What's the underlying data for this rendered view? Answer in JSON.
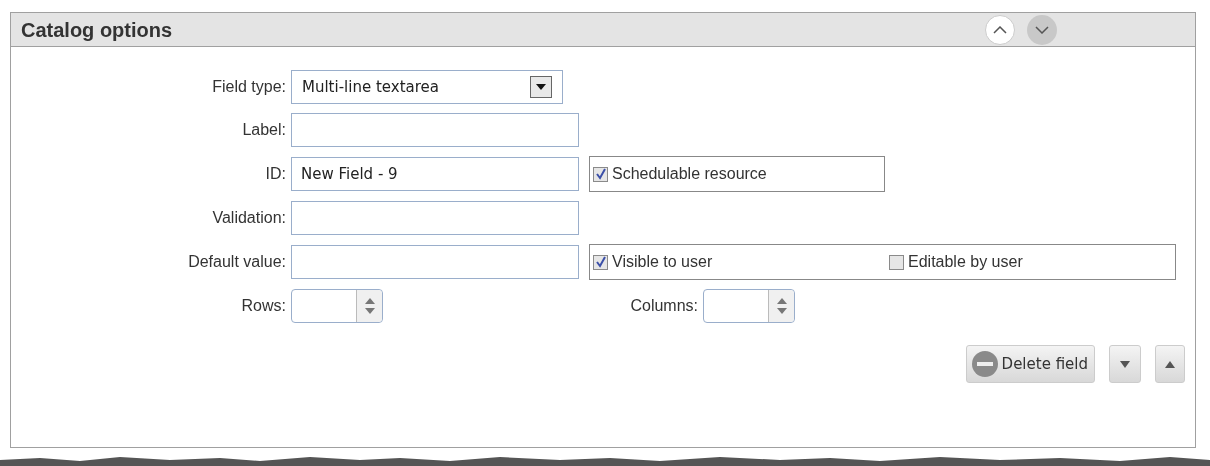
{
  "panel": {
    "title": "Catalog options"
  },
  "fields": [
    {
      "kind": "select",
      "label": "Field type:",
      "value": "Multi-line textarea"
    },
    {
      "kind": "text",
      "label": "Label:"
    },
    {
      "kind": "text",
      "label": "ID:",
      "value": "New Field - 9",
      "checkboxes": [
        {
          "label": "Schedulable resource",
          "checked": true
        }
      ]
    },
    {
      "kind": "text",
      "label": "Validation:"
    },
    {
      "kind": "text",
      "label": "Default value:",
      "checkboxes": [
        {
          "label": "Visible to user",
          "checked": true
        },
        {
          "label": "Editable by user",
          "checked": false
        }
      ]
    }
  ],
  "spinners": [
    {
      "label": "Rows:"
    },
    {
      "label": "Columns:"
    }
  ],
  "delete_button": "Delete field"
}
